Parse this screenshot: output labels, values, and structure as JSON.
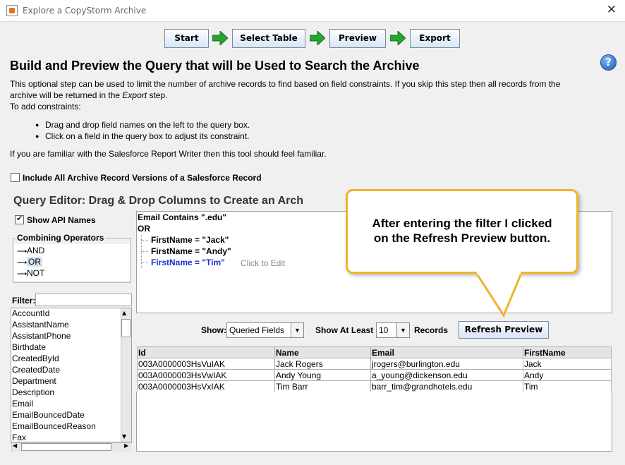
{
  "window": {
    "title": "Explore a CopyStorm Archive",
    "close_glyph": "✕"
  },
  "wizard": {
    "steps": [
      "Start",
      "Select Table",
      "Preview",
      "Export"
    ],
    "arrow_color": "#27a32f"
  },
  "help": {
    "glyph": "?"
  },
  "heading": "Build and Preview the Query that will be Used to Search the Archive",
  "intro": {
    "line1": "This optional step can be used to limit the number of archive records to find based on field constraints. If you skip this step then all records from the",
    "line2_pre": "archive will be returned in the ",
    "line2_em": "Export",
    "line2_post": " step.",
    "line3": "To add constraints:",
    "bullets": [
      "Drag and drop field names on the left to the query box.",
      "Click on a field in the query box to adjust its constraint."
    ],
    "line4": "If you are familiar with the Salesforce Report Writer then this tool should feel familiar."
  },
  "include_versions": {
    "label": "Include All Archive Record Versions of a Salesforce Record",
    "checked": false
  },
  "query_editor": {
    "title": "Query Editor: Drag & Drop Columns to Create an Arch",
    "show_api_names": {
      "label": "Show API Names",
      "checked": true
    },
    "operators": {
      "title": "Combining Operators",
      "items": [
        "AND",
        "OR",
        "NOT"
      ],
      "selected": "OR"
    },
    "filter_label": "Filter:",
    "filter_value": "",
    "fields": [
      "AccountId",
      "AssistantName",
      "AssistantPhone",
      "Birthdate",
      "CreatedById",
      "CreatedDate",
      "Department",
      "Description",
      "Email",
      "EmailBouncedDate",
      "EmailBouncedReason",
      "Fax"
    ],
    "query": {
      "line1": "Email Contains \".edu\"",
      "line2": "OR",
      "children": [
        "FirstName = \"Jack\"",
        "FirstName = \"Andy\"",
        "FirstName = \"Tim\""
      ],
      "hint": "Click to Edit",
      "selected_color": "#1a2fd4"
    }
  },
  "preview": {
    "show_label": "Show:",
    "show_value": "Queried Fields",
    "atleast_label": "Show At Least",
    "atleast_value": "10",
    "records_label": "Records",
    "refresh_button": "Refresh Preview",
    "columns": [
      "Id",
      "Name",
      "Email",
      "FirstName"
    ],
    "rows": [
      [
        "003A0000003HsVuIAK",
        "Jack Rogers",
        "jrogers@burlington.edu",
        "Jack"
      ],
      [
        "003A0000003HsVwIAK",
        "Andy Young",
        "a_young@dickenson.edu",
        "Andy"
      ],
      [
        "003A0000003HsVxIAK",
        "Tim Barr",
        "barr_tim@grandhotels.edu",
        "Tim"
      ]
    ]
  },
  "callout": {
    "line1": "After entering the filter I clicked",
    "line2": "on the Refresh Preview button.",
    "border_color": "#f0b429"
  }
}
